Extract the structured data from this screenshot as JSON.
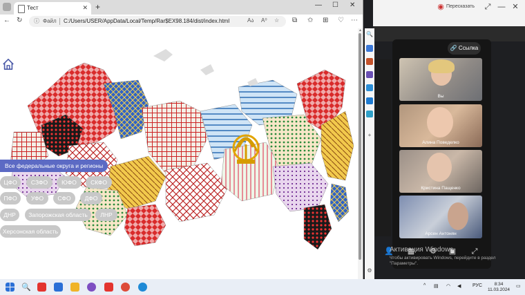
{
  "browser": {
    "tab_title": "Тест",
    "tab_close": "✕",
    "new_tab": "+",
    "window_minimize": "—",
    "window_maximize": "☐",
    "window_close": "✕",
    "address_label": "Файл",
    "url": "C:/Users/USER/AppData/Local/Temp/Rar$EX98.184/dist/index.html",
    "read_aloud": "Aₕ",
    "text_size": "A⁰"
  },
  "page": {
    "region_title": "Все федеральные округа и регионы",
    "districts": [
      {
        "label": "ЦФО"
      },
      {
        "label": "СЗФО"
      },
      {
        "label": "ЮФО"
      },
      {
        "label": "СКФО"
      },
      {
        "label": "ПФО"
      },
      {
        "label": "УФО"
      },
      {
        "label": "СФО"
      },
      {
        "label": "ДФО"
      },
      {
        "label": "ДНР"
      },
      {
        "label": "Запорожская область"
      },
      {
        "label": "ЛНР"
      },
      {
        "label": "Херсонская область"
      }
    ],
    "colors": {
      "title_bg": "#5c6ac4",
      "pill_bg": "#c8c8c8"
    }
  },
  "video_call": {
    "share_button": "Пересказать",
    "link_button": "Ссылка",
    "participants": [
      {
        "name": "Вы"
      },
      {
        "name": "Алина Поведелко"
      },
      {
        "name": "Кристина Пащенко"
      },
      {
        "name": "Арсен Антонян"
      }
    ]
  },
  "windows": {
    "activate_title": "Активация Windows",
    "activate_hint": "Чтобы активировать Windows, перейдите в раздел \"Параметры\".",
    "language": "РУС",
    "time": "8:34",
    "date": "11.03.2024"
  }
}
